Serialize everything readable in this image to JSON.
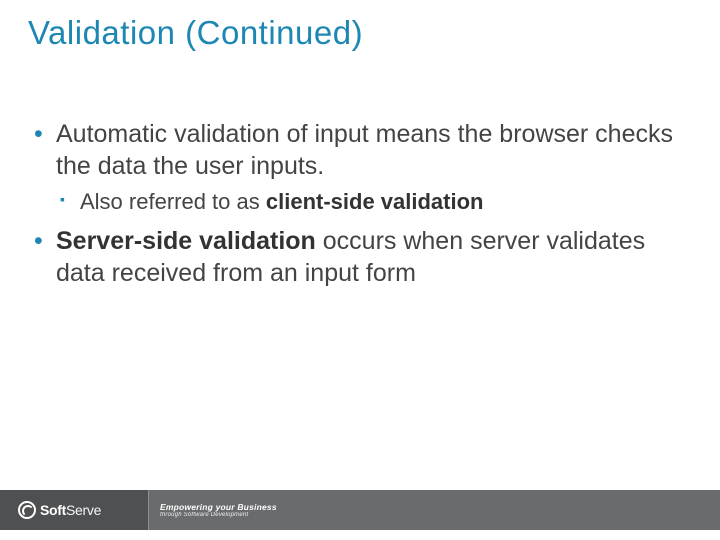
{
  "title": "Validation (Continued)",
  "bullets": {
    "b1_pre": "Automatic validation of input means the browser checks the data the user inputs.",
    "b1_sub_pre": "Also referred to as ",
    "b1_sub_bold": "client-side validation",
    "b2_bold": "Server-side validation",
    "b2_post": " occurs when server validates data received from an input form"
  },
  "footer": {
    "brand_bold": "Soft",
    "brand_light": "Serve",
    "tagline1": "Empowering your Business",
    "tagline2": "through Software Development"
  }
}
